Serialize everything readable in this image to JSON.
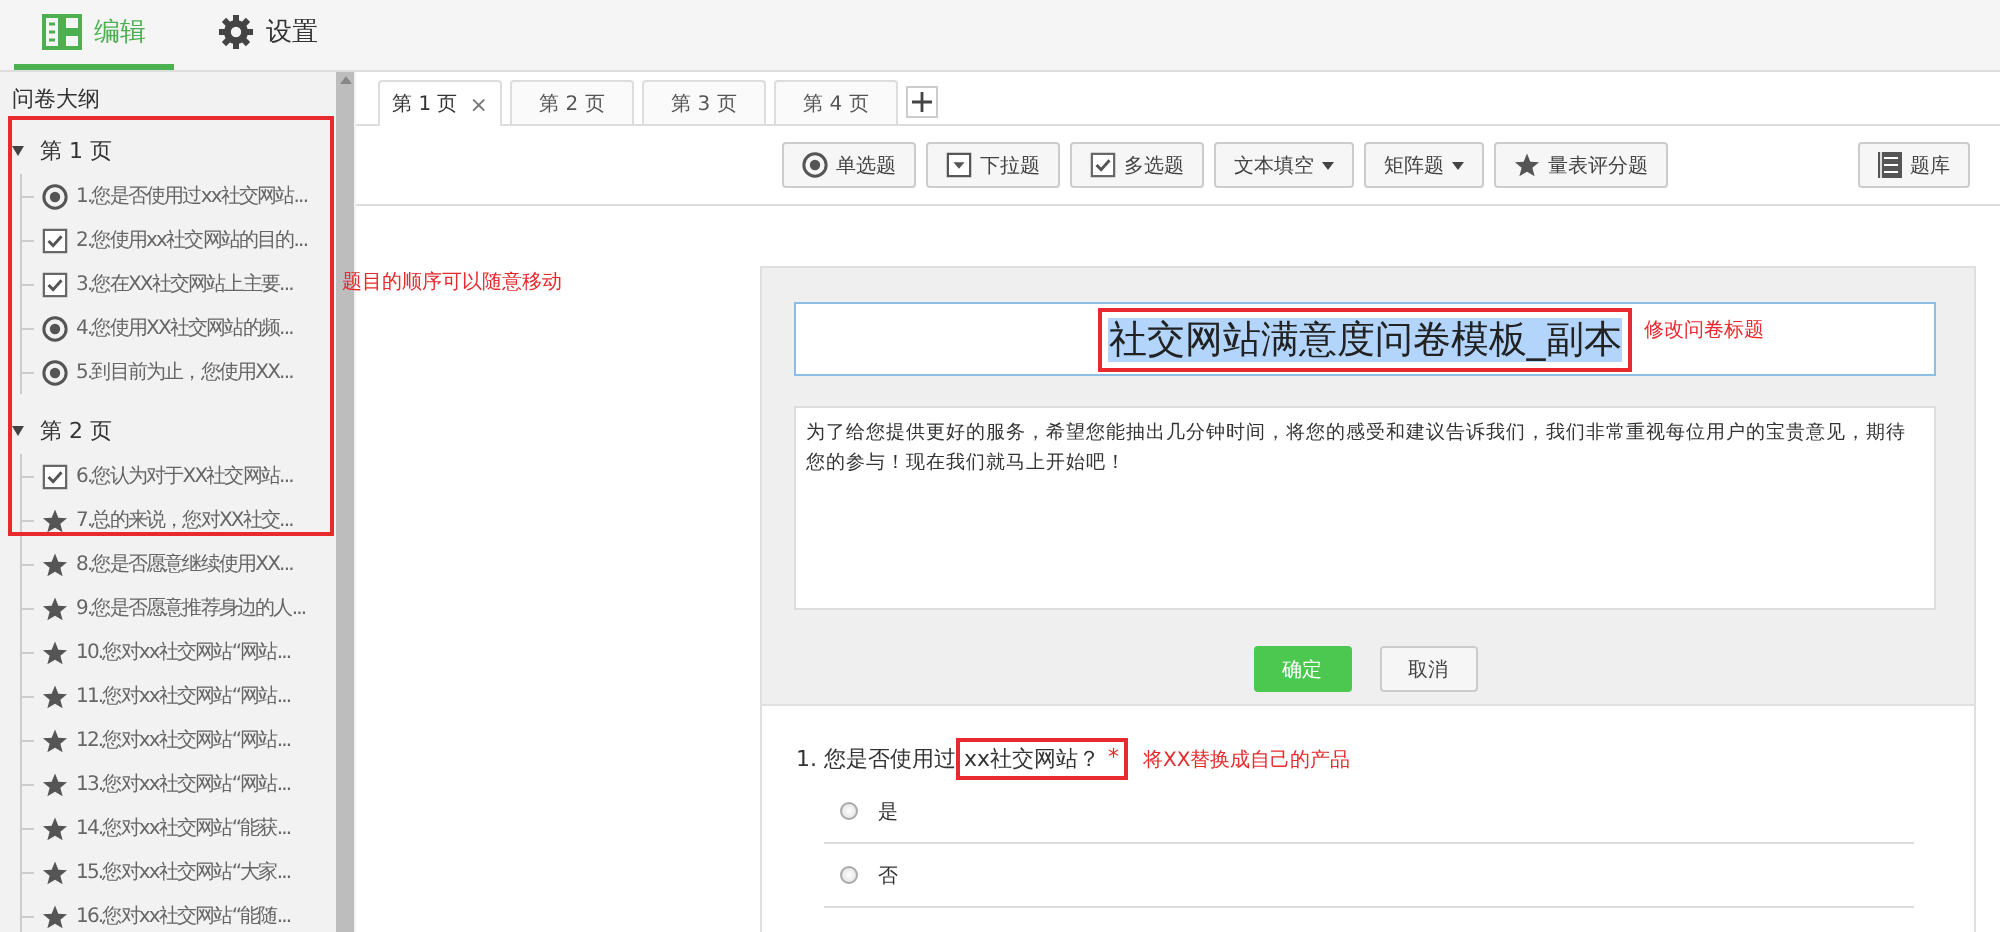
{
  "top_tabs": [
    {
      "label": "编辑",
      "kind": "form",
      "selected": true
    },
    {
      "label": "设置",
      "kind": "gear",
      "selected": false
    }
  ],
  "sidebar": {
    "title": "问卷大纲",
    "annotation": "题目的顺序可以随意移动",
    "pages": [
      {
        "label": "第 1 页",
        "expanded": true,
        "children": [
          {
            "kind": "radio",
            "text": "1.您是否使用过xx社交网站..."
          },
          {
            "kind": "checkbox",
            "text": "2.您使用xx社交网站的目的..."
          },
          {
            "kind": "checkbox",
            "text": "3.您在XX社交网站上主要..."
          },
          {
            "kind": "radio",
            "text": "4.您使用XX社交网站的频..."
          },
          {
            "kind": "radio",
            "text": "5.到目前为止，您使用XX..."
          }
        ]
      },
      {
        "label": "第 2 页",
        "expanded": true,
        "children": [
          {
            "kind": "checkbox",
            "text": "6.您认为对于XX社交网站..."
          },
          {
            "kind": "star",
            "text": "7.总的来说，您对XX社交..."
          },
          {
            "kind": "star",
            "text": "8.您是否愿意继续使用XX..."
          },
          {
            "kind": "star",
            "text": "9.您是否愿意推荐身边的人..."
          },
          {
            "kind": "star",
            "text": "10.您对xx社交网站“网站..."
          },
          {
            "kind": "star",
            "text": "11.您对xx社交网站“网站..."
          },
          {
            "kind": "star",
            "text": "12.您对xx社交网站“网站..."
          },
          {
            "kind": "star",
            "text": "13.您对xx社交网站“网站..."
          },
          {
            "kind": "star",
            "text": "14.您对xx社交网站“能获..."
          },
          {
            "kind": "star",
            "text": "15.您对xx社交网站“大家..."
          },
          {
            "kind": "star",
            "text": "16.您对xx社交网站“能随..."
          }
        ]
      }
    ]
  },
  "page_tabs": [
    {
      "label": "第 1 页",
      "selected": true,
      "close": "×"
    },
    {
      "label": "第 2 页",
      "selected": false
    },
    {
      "label": "第 3 页",
      "selected": false
    },
    {
      "label": "第 4 页",
      "selected": false
    }
  ],
  "toolbar": {
    "buttons": [
      {
        "label": "单选题",
        "kind": "radio",
        "menu": false
      },
      {
        "label": "下拉题",
        "kind": "dropdown",
        "menu": false
      },
      {
        "label": "多选题",
        "kind": "checkbox",
        "menu": false
      },
      {
        "label": "文本填空",
        "kind": "text",
        "menu": true
      },
      {
        "label": "矩阵题",
        "kind": "matrix",
        "menu": true
      },
      {
        "label": "量表评分题",
        "kind": "star",
        "menu": false
      }
    ],
    "library": {
      "label": "题库"
    }
  },
  "editor": {
    "title": "社交网站满意度问卷模板_副本",
    "title_selected": true,
    "title_annotation": "修改问卷标题",
    "description": "为了给您提供更好的服务，希望您能抽出几分钟时间，将您的感受和建议告诉我们，我们非常重视每位用户的宝贵意见，期待您的参与！现在我们就马上开始吧！",
    "buttons": [
      {
        "label": "确定",
        "kind": "primary"
      },
      {
        "label": "取消",
        "kind": "default"
      }
    ]
  },
  "question": {
    "number": "1.",
    "text_before": "您是否使用过",
    "text_boxed": "xx社交网站？",
    "required_mark": "*",
    "annotation": "将XX替换成自己的产品",
    "options": [
      {
        "label": "是",
        "selected": false
      },
      {
        "label": "否",
        "selected": false
      }
    ]
  }
}
